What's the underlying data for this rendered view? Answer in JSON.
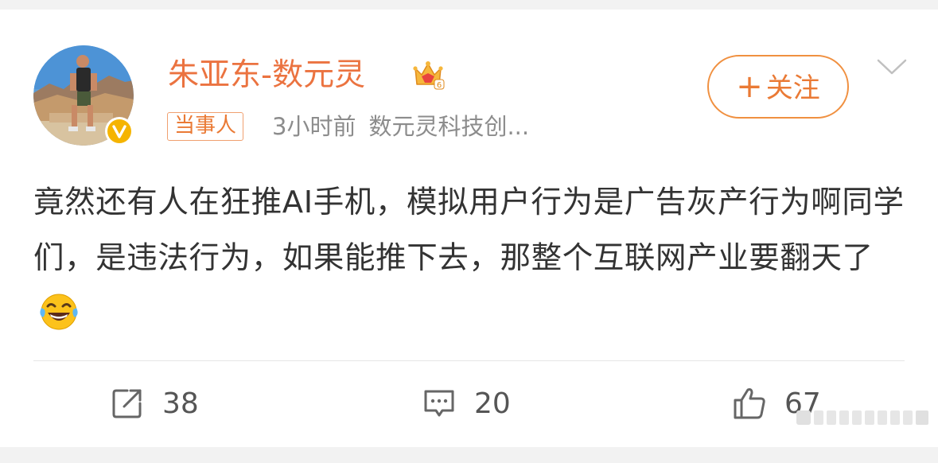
{
  "post": {
    "username": "朱亚东-数元灵",
    "tag": "当事人",
    "time": "3小时前",
    "source": "数元灵科技创...",
    "follow_label": "关注",
    "content": "竟然还有人在狂推AI手机，模拟用户行为是广告灰产行为啊同学们，是违法行为，如果能推下去，那整个互联网产业要翻天了"
  },
  "actions": {
    "repost_count": "38",
    "comment_count": "20",
    "like_count": "67"
  },
  "icons": {
    "verified": "verified-badge-icon",
    "crown": "vip-crown-icon",
    "emoji": "laughing-tears-emoji",
    "more": "chevron-down-icon",
    "repost": "repost-icon",
    "comment": "comment-icon",
    "like": "thumbs-up-icon"
  },
  "colors": {
    "accent": "#eb7340",
    "verified": "#f5b400",
    "text": "#333333",
    "meta": "#8c8c8c"
  }
}
